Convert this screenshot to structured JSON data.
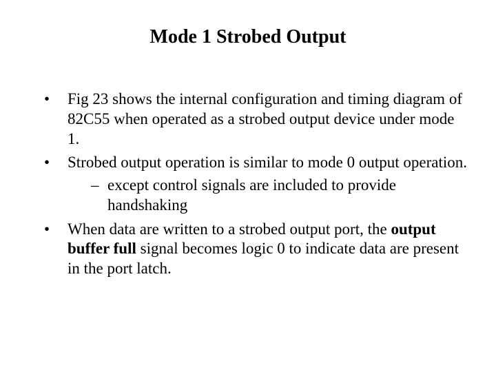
{
  "title": "Mode 1 Strobed Output",
  "bullets": {
    "b1": "Fig 23 shows the internal configuration and timing diagram of 82C55 when operated as a strobed output device under mode 1.",
    "b2": "Strobed output operation is similar to mode 0 output operation.",
    "b2_sub1": "except control signals are included to provide handshaking",
    "b3_pre": "When data are written to a strobed output port, the ",
    "b3_bold": "output buffer full",
    "b3_post": " signal becomes logic 0 to indicate data are present in the port latch."
  }
}
